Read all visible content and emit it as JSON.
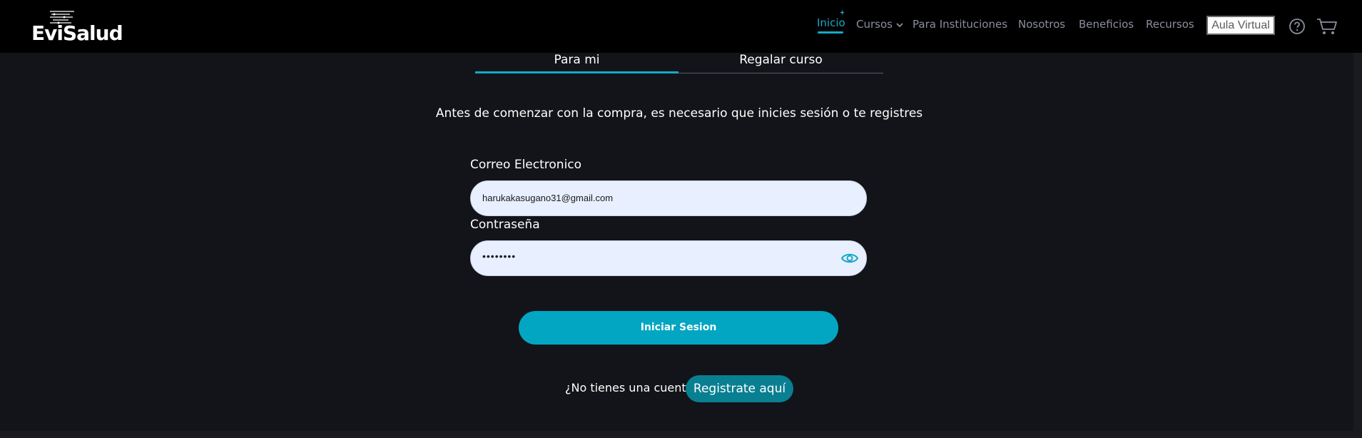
{
  "header": {
    "logo_text": "EviSalud",
    "nav": [
      {
        "label": "Inicio",
        "active": true
      },
      {
        "label": "Cursos",
        "has_dropdown": true
      },
      {
        "label": "Para Instituciones"
      },
      {
        "label": "Nosotros"
      },
      {
        "label": "Beneficios"
      },
      {
        "label": "Recursos"
      }
    ],
    "aula_label": "Aula Virtual",
    "icons": [
      "help-icon",
      "cart-icon"
    ]
  },
  "tabs": [
    {
      "label": "Para mi",
      "selected": true
    },
    {
      "label": "Regalar curso",
      "selected": false
    }
  ],
  "intro_text": "Antes de comenzar con la compra, es necesario que inicies sesión o te registres",
  "form": {
    "email_label": "Correo Electronico",
    "email_value": "harukakasugano31@gmail.com",
    "password_label": "Contraseña",
    "password_value": "••••••••",
    "login_label": "Iniciar Sesion",
    "no_account_text": "¿No tienes una cuenta?",
    "register_label": "Registrate aquí"
  },
  "colors": {
    "accent": "#15a9c6",
    "button": "#02a6c2",
    "register_button": "#097f92",
    "background": "#131419",
    "header": "#000000"
  }
}
